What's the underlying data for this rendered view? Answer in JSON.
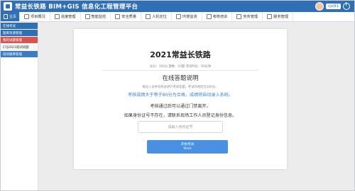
{
  "header": {
    "title": "常益长铁路 BIM+GIS 信息化工程管理平台",
    "user_name": "cjx91"
  },
  "nav": {
    "items": [
      {
        "label": "主页",
        "icon": "home-icon"
      },
      {
        "label": "项目概况",
        "icon": "map-icon"
      },
      {
        "label": "进度管理",
        "icon": "progress-icon"
      },
      {
        "label": "智能监控",
        "icon": "monitor-icon"
      },
      {
        "label": "安全质量",
        "icon": "shield-icon"
      },
      {
        "label": "人机定位",
        "icon": "location-icon"
      },
      {
        "label": "环境监测",
        "icon": "env-icon"
      },
      {
        "label": "考核培训",
        "icon": "training-icon"
      },
      {
        "label": "劳务管理",
        "icon": "people-icon"
      },
      {
        "label": "服务管理",
        "icon": "service-icon"
      }
    ]
  },
  "sidebar": {
    "items": [
      {
        "label": "在线考试",
        "style": "blue"
      },
      {
        "label": "题库资源管理",
        "style": "blue"
      },
      {
        "label": "我的试题管理",
        "style": "red"
      },
      {
        "label": "CYJ2021培训试题",
        "style": "plain"
      },
      {
        "label": "培训题库管理",
        "style": "blue2"
      }
    ]
  },
  "exam": {
    "title": "2021常益长铁路",
    "meta": "总分：100分  题数：10题  考试时长：60分钟",
    "instructions_title": "在线答题说明",
    "line1": "每位人员共有机会进行考试答题，考试开始后为100分。",
    "line2": "考核成绩大于等于80分为合格，成绩将自动录入系统。",
    "line3": "考核通过后可以通过门禁离开。",
    "line4": "如果身份证号不存在，请联系现场工作人员登记身份信息。",
    "id_placeholder": "请输入身份证号",
    "start_label_cn": "开始考试",
    "start_label_en": "Start"
  },
  "colors": {
    "brand": "#2f6fb5",
    "accent_text": "#3a80d2",
    "button": "#4a90e2",
    "sidebar_active": "#d9534f"
  }
}
